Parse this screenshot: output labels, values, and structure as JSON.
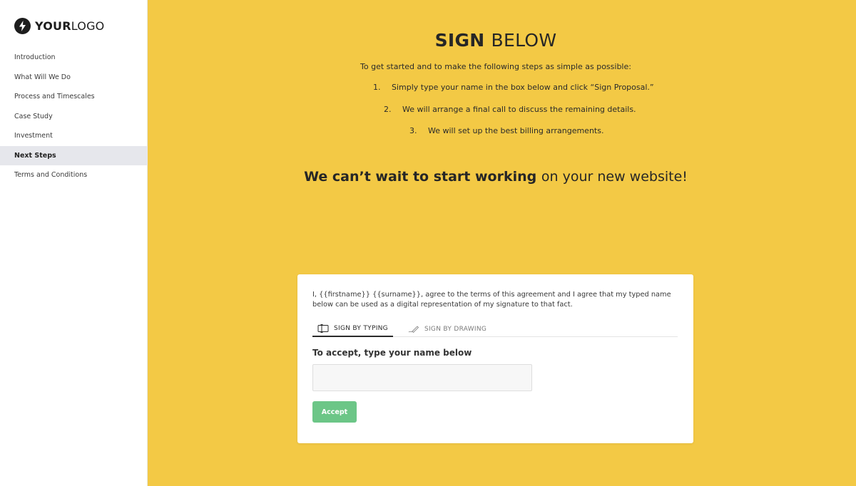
{
  "logo": {
    "bold": "YOUR",
    "light": "LOGO",
    "icon": "lightning-bolt-icon"
  },
  "sidebar": {
    "items": [
      {
        "label": "Introduction",
        "active": false
      },
      {
        "label": "What Will We Do",
        "active": false
      },
      {
        "label": "Process and Timescales",
        "active": false
      },
      {
        "label": "Case Study",
        "active": false
      },
      {
        "label": "Investment",
        "active": false
      },
      {
        "label": "Next Steps",
        "active": true
      },
      {
        "label": "Terms and Conditions",
        "active": false
      }
    ]
  },
  "main": {
    "heading_bold": "SIGN",
    "heading_light": "BELOW",
    "intro": "To get started and to make the following steps as simple as possible:",
    "steps": [
      {
        "num": "1.",
        "text": "Simply type your name in the box below and click “Sign Proposal.”"
      },
      {
        "num": "2.",
        "text": "We will arrange a final call to discuss the remaining details."
      },
      {
        "num": "3.",
        "text": "We will set up the best billing arrangements."
      }
    ],
    "tagline_bold": "We can’t wait to start working",
    "tagline_light": "on your new website!",
    "background_color": "#f3c945"
  },
  "card": {
    "agreement": "I, {{firstname}} {{surname}}, agree to the terms of this agreement and I agree that my typed name below can be used as a digital representation of my signature to that fact.",
    "tabs": [
      {
        "label": "SIGN BY TYPING",
        "icon": "keyboard-icon",
        "active": true
      },
      {
        "label": "SIGN BY DRAWING",
        "icon": "pen-icon",
        "active": false
      }
    ],
    "accept_label": "To accept, type your name below",
    "name_value": "",
    "name_placeholder": "",
    "accept_button": "Accept",
    "accept_color": "#6cc687"
  }
}
